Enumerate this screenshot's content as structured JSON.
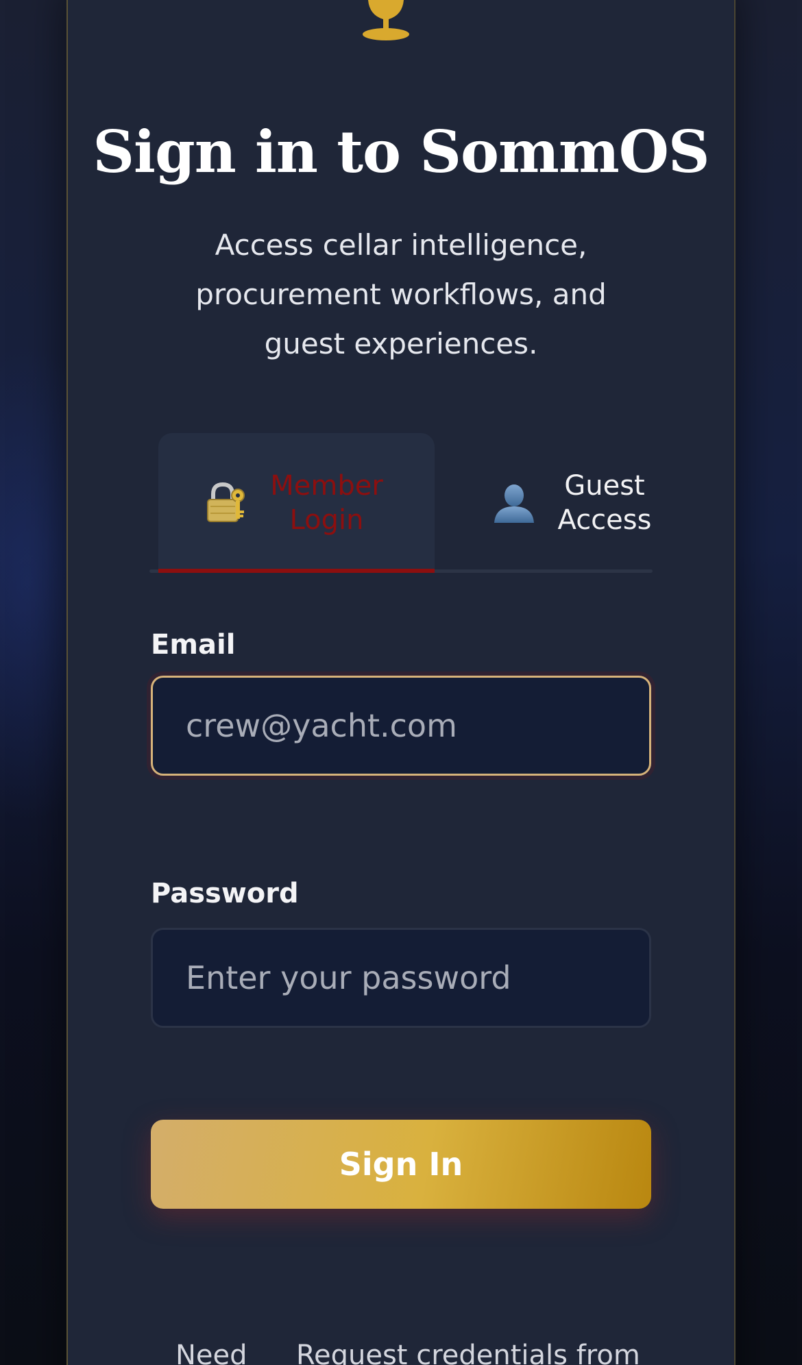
{
  "colors": {
    "accent_gold": "#d9b13e",
    "active_tab_red": "#8c0f0f",
    "card_bg": "#1f2638",
    "input_bg": "#141d35"
  },
  "header": {
    "logo_icon": "goblet-icon",
    "title": "Sign in to SommOS",
    "subtitle": "Access cellar intelligence, procurement workflows, and guest experiences."
  },
  "tabs": [
    {
      "icon": "lock-with-key-icon",
      "icon_glyph": "🔐",
      "label": "Member Login",
      "active": true
    },
    {
      "icon": "user-silhouette-icon",
      "icon_glyph": "👤",
      "label": "Guest Access",
      "active": false
    }
  ],
  "form": {
    "email_label": "Email",
    "email_placeholder": "crew@yacht.com",
    "email_value": "",
    "password_label": "Password",
    "password_placeholder": "Enter your password",
    "password_value": "",
    "submit_label": "Sign In"
  },
  "footer": {
    "need_text": "Need",
    "request_text": "Request credentials from"
  }
}
